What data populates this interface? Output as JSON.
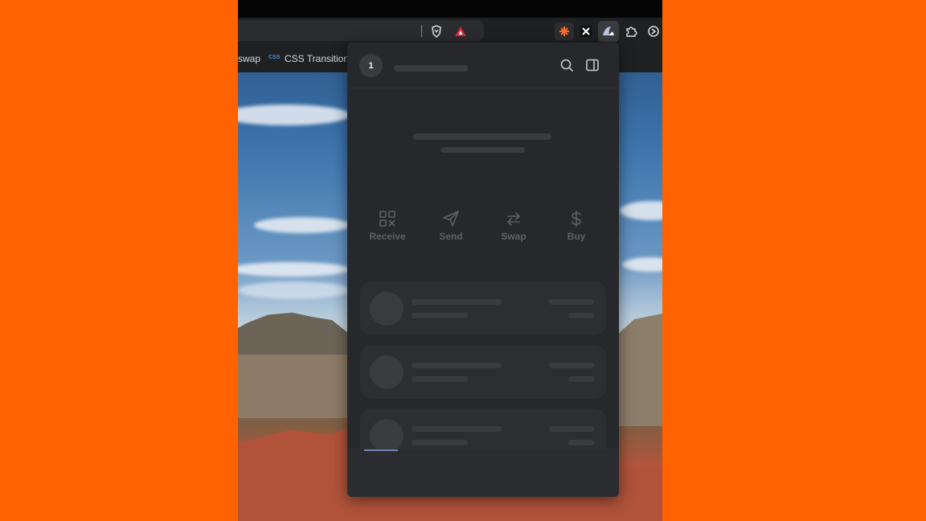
{
  "browser": {
    "bookmarks": [
      {
        "label": "swap"
      },
      {
        "favicon_text": "CSS",
        "label": "CSS Transition g"
      }
    ],
    "extension_icons": [
      "brave-icon",
      "triangle-alert-icon",
      "asterisk-extension-icon",
      "x-extension-icon",
      "wallet-extension-icon",
      "puzzle-icon",
      "sidebar-toggle-icon"
    ]
  },
  "wallet": {
    "account_number": "1",
    "actions": [
      {
        "label": "Receive",
        "icon": "qr-code-icon"
      },
      {
        "label": "Send",
        "icon": "send-icon"
      },
      {
        "label": "Swap",
        "icon": "swap-icon"
      },
      {
        "label": "Buy",
        "icon": "dollar-icon"
      }
    ],
    "asset_rows": 3,
    "state": "loading"
  },
  "colors": {
    "page_background": "#ff6200",
    "popup_background": "#27282b",
    "skeleton": "#3a3b3e",
    "action_text": "#5f6066"
  }
}
